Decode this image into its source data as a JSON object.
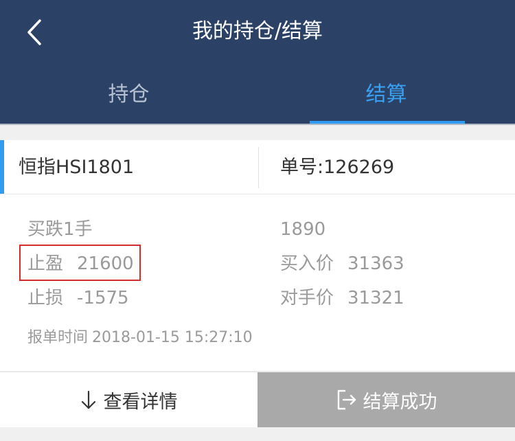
{
  "header": {
    "title": "我的持仓/结算",
    "back_icon": "chevron-left-icon",
    "tabs": [
      {
        "label": "持仓",
        "active": false
      },
      {
        "label": "结算",
        "active": true
      }
    ],
    "colors": {
      "background": "#2b4166",
      "active_tab": "#3aa0f0",
      "accent": "#2f9bf2"
    }
  },
  "order": {
    "product": "恒指HSI1801",
    "order_no_label": "单号:",
    "order_no": "126269",
    "direction": "买跌1手",
    "amount": "1890",
    "take_profit": {
      "label": "止盈",
      "value": "21600"
    },
    "stop_loss": {
      "label": "止损",
      "value": "-1575"
    },
    "buy_price": {
      "label": "买入价",
      "value": "31363"
    },
    "counter_price": {
      "label": "对手价",
      "value": "31321"
    },
    "order_time": {
      "label": "报单时间",
      "value": "2018-01-15 15:27:10"
    }
  },
  "actions": {
    "detail_label": "查看详情",
    "detail_icon": "arrow-down-icon",
    "settle_label": "结算成功",
    "settle_icon": "exit-icon"
  }
}
